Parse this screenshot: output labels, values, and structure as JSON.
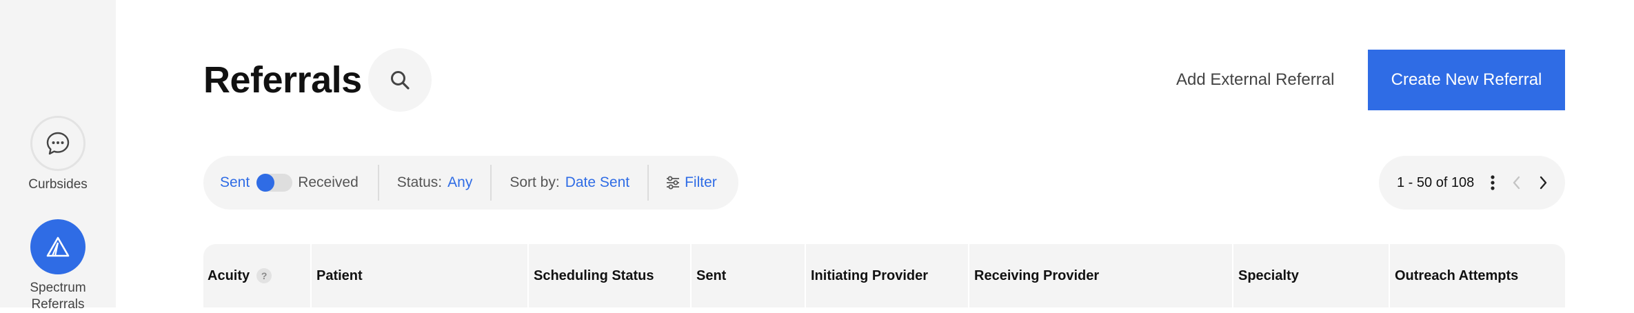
{
  "sidebar": {
    "items": [
      {
        "label": "Curbsides",
        "icon": "chat-bubble-icon"
      },
      {
        "label_line1": "Spectrum",
        "label_line2": "Referrals",
        "icon": "spectrum-logo-icon",
        "active": true
      }
    ]
  },
  "header": {
    "title": "Referrals",
    "add_external_label": "Add External Referral",
    "create_new_label": "Create New Referral"
  },
  "filters": {
    "sent_label": "Sent",
    "received_label": "Received",
    "toggle_state": "sent",
    "status_label": "Status:",
    "status_value": "Any",
    "sort_label": "Sort by:",
    "sort_value": "Date Sent",
    "filter_label": "Filter"
  },
  "pagination": {
    "range_text": "1 - 50 of 108"
  },
  "table": {
    "columns": [
      "Acuity",
      "Patient",
      "Scheduling Status",
      "Sent",
      "Initiating Provider",
      "Receiving Provider",
      "Specialty",
      "Outreach Attempts"
    ],
    "acuity_help": "?"
  },
  "colors": {
    "accent": "#2f6ce5",
    "sidebar_bg": "#f4f4f4",
    "pill_bg": "#f4f4f4"
  }
}
